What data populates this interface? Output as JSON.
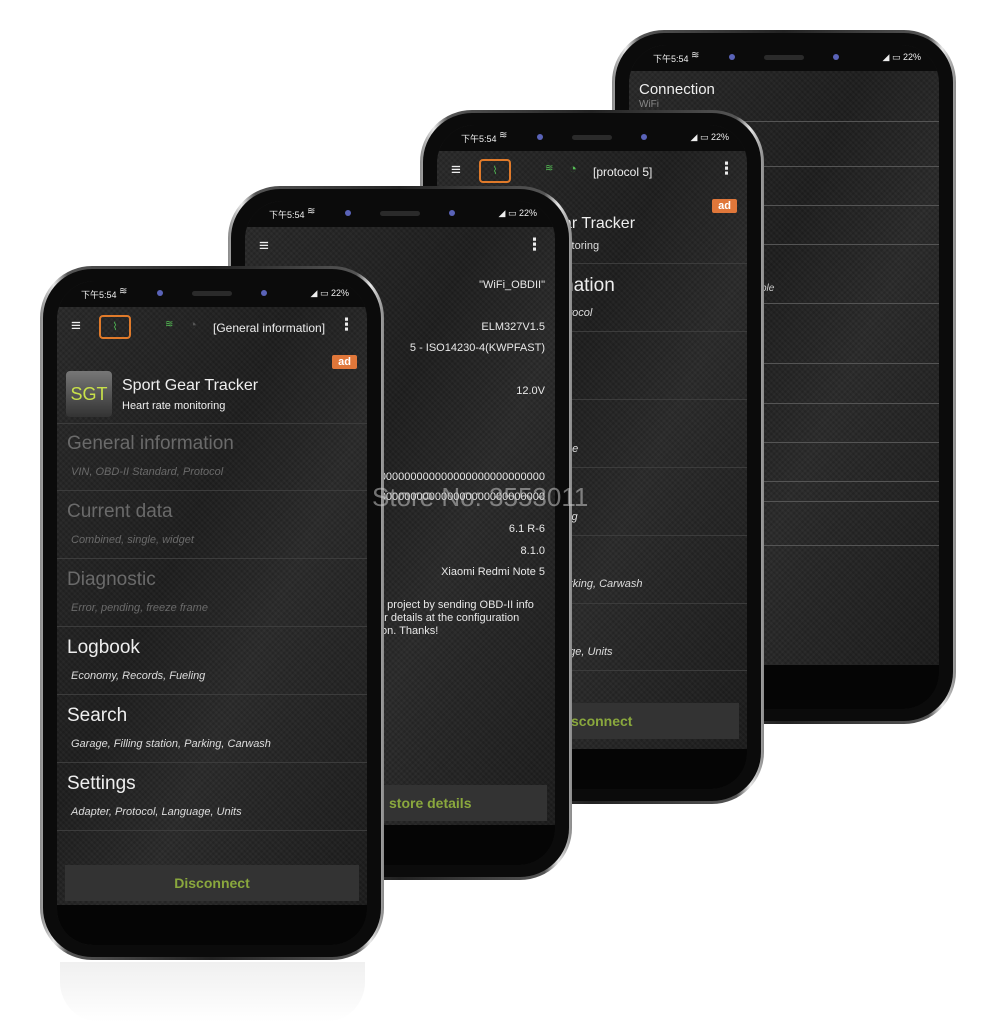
{
  "status": {
    "time": "下午5:54",
    "wifi_icon": "wifi-icon",
    "signal_icon": "signal-icon",
    "battery": "22%"
  },
  "colors": {
    "accent_orange": "#e0773a",
    "button_text": "#8aa83d",
    "wifi_green": "#55c055"
  },
  "watermark": "Store No: 3553011",
  "phone1": {
    "toolbar_title": "[General information]",
    "ad_label": "ad",
    "ad_app": {
      "icon_text": "SGT",
      "title": "Sport Gear Tracker",
      "subtitle": "Heart rate monitoring"
    },
    "menu": [
      {
        "title": "General information",
        "subtitle": "VIN, OBD-II Standard, Protocol",
        "enabled": false
      },
      {
        "title": "Current data",
        "subtitle": "Combined, single, widget",
        "enabled": false
      },
      {
        "title": "Diagnostic",
        "subtitle": "Error, pending, freeze frame",
        "enabled": false
      },
      {
        "title": "Logbook",
        "subtitle": "Economy, Records, Fueling",
        "enabled": true
      },
      {
        "title": "Search",
        "subtitle": "Garage, Filling station, Parking, Carwash",
        "enabled": true
      },
      {
        "title": "Settings",
        "subtitle": "Adapter, Protocol, Language, Units",
        "enabled": true
      }
    ],
    "button": "Disconnect"
  },
  "phone2": {
    "values": [
      "\"WiFi_OBDII\"",
      "ELM327V1.5",
      "5 - ISO14230-4(KWPFAST)",
      "12.0V",
      "000000000000000000000000000",
      "000000000000000000000000000",
      "6.1  R-6",
      "8.1.0",
      "Xiaomi Redmi Note 5"
    ],
    "paragraph": [
      "e project by sending OBD-II info",
      "ar details at the configuration",
      "ton. Thanks!"
    ],
    "button": "store details"
  },
  "phone3": {
    "toolbar_title": "[protocol 5]",
    "ad_label": "ad",
    "fragments": [
      "ar Tracker",
      "nitoring",
      "nation",
      "otocol",
      "me",
      "ing",
      "arking, Carwash",
      "age, Units"
    ],
    "button": "sconnect"
  },
  "phone4": {
    "title": "Connection",
    "subtitle": "WiFi",
    "fragment": "ble"
  }
}
